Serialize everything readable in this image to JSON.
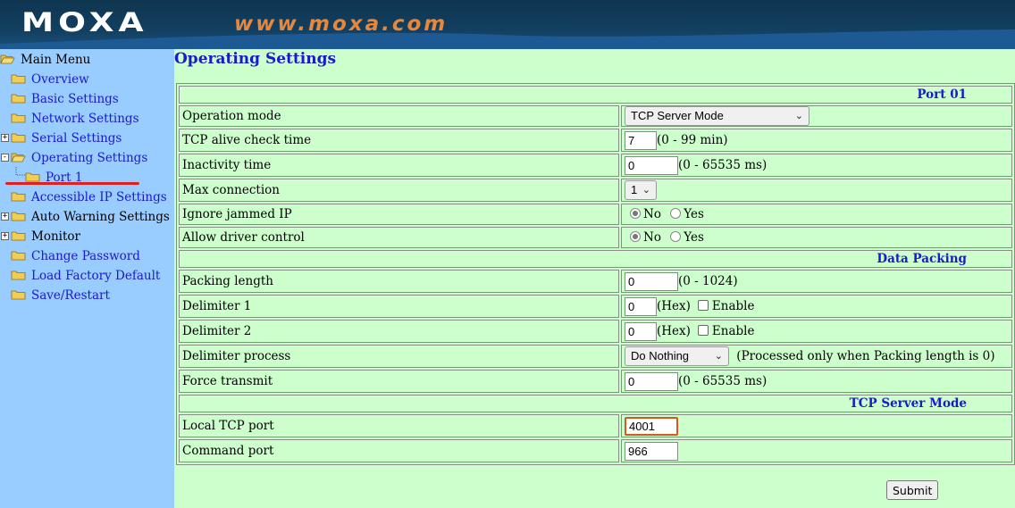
{
  "header": {
    "logo_text": "MOXA",
    "site_url": "www.moxa.com"
  },
  "colors": {
    "sidebar_bg": "#99ccff",
    "content_bg": "#ccffcc",
    "link": "#1a1acc",
    "url_orange": "#e8873a",
    "banner_dark": "#0f3550",
    "focus_border": "#d25a1f"
  },
  "sidebar": {
    "items": [
      {
        "label": "Main Menu",
        "icon": "folder-open-icon"
      },
      {
        "label": "Overview",
        "icon": "folder-icon"
      },
      {
        "label": "Basic Settings",
        "icon": "folder-icon"
      },
      {
        "label": "Network Settings",
        "icon": "folder-icon"
      },
      {
        "label": "Serial Settings",
        "icon": "folder-icon",
        "expander": "+"
      },
      {
        "label": "Operating Settings",
        "icon": "folder-open-icon",
        "expander": "-"
      },
      {
        "label": "Port 1",
        "icon": "folder-icon"
      },
      {
        "label": "Accessible IP Settings",
        "icon": "folder-icon"
      },
      {
        "label": "Auto Warning Settings",
        "icon": "folder-icon",
        "expander": "+"
      },
      {
        "label": "Monitor",
        "icon": "folder-icon",
        "expander": "+"
      },
      {
        "label": "Change Password",
        "icon": "folder-icon"
      },
      {
        "label": "Load Factory Default",
        "icon": "folder-icon"
      },
      {
        "label": "Save/Restart",
        "icon": "folder-icon"
      }
    ]
  },
  "main": {
    "title": "Operating Settings",
    "sections": {
      "port": "Port 01",
      "packing": "Data Packing",
      "tcp": "TCP Server Mode"
    },
    "rows": {
      "operation_mode": {
        "label": "Operation mode",
        "value": "TCP Server Mode"
      },
      "tcp_alive": {
        "label": "TCP alive check time",
        "value": "7",
        "hint": "(0 - 99 min)"
      },
      "inactivity": {
        "label": "Inactivity time",
        "value": "0",
        "hint": "(0 - 65535 ms)"
      },
      "max_conn": {
        "label": "Max connection",
        "value": "1"
      },
      "ignore_jammed": {
        "label": "Ignore jammed IP",
        "opt_no": "No",
        "opt_yes": "Yes",
        "selected": "No"
      },
      "allow_driver": {
        "label": "Allow driver control",
        "opt_no": "No",
        "opt_yes": "Yes",
        "selected": "No"
      },
      "packing_length": {
        "label": "Packing length",
        "value": "0",
        "hint": "(0 - 1024)"
      },
      "delim1": {
        "label": "Delimiter 1",
        "value": "0",
        "hex": "(Hex)",
        "enable": "Enable"
      },
      "delim2": {
        "label": "Delimiter 2",
        "value": "0",
        "hex": "(Hex)",
        "enable": "Enable"
      },
      "delim_process": {
        "label": "Delimiter process",
        "value": "Do Nothing",
        "hint": "(Processed only when Packing length is 0)"
      },
      "force_transmit": {
        "label": "Force transmit",
        "value": "0",
        "hint": "(0 - 65535 ms)"
      },
      "local_tcp": {
        "label": "Local TCP port",
        "value": "4001"
      },
      "command_port": {
        "label": "Command port",
        "value": "966"
      }
    },
    "submit_label": "Submit"
  }
}
